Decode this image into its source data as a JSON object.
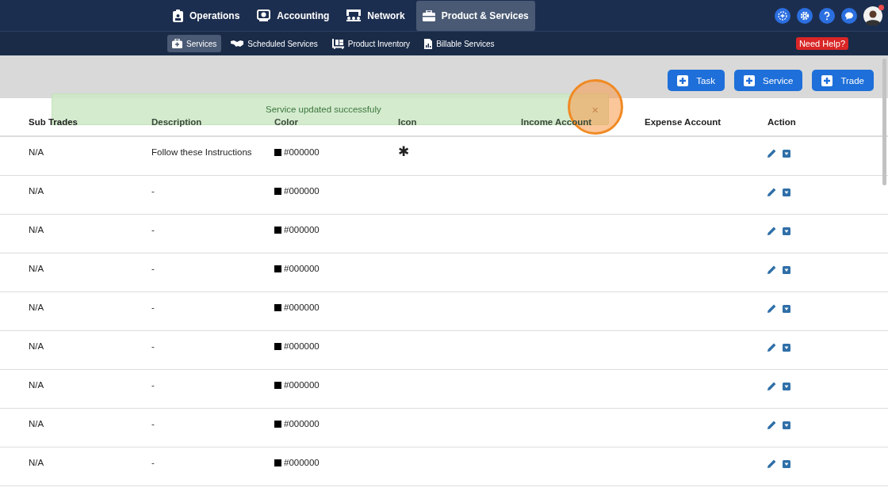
{
  "top_nav": [
    {
      "label": "Operations",
      "selected": false
    },
    {
      "label": "Accounting",
      "selected": false
    },
    {
      "label": "Network",
      "selected": false
    },
    {
      "label": "Product & Services",
      "selected": true
    }
  ],
  "sub_nav": [
    {
      "label": "Services",
      "selected": true
    },
    {
      "label": "Scheduled Services",
      "selected": false
    },
    {
      "label": "Product Inventory",
      "selected": false
    },
    {
      "label": "Billable Services",
      "selected": false
    }
  ],
  "help_badge": "Need Help?",
  "action_buttons": [
    "Task",
    "Service",
    "Trade"
  ],
  "toast": {
    "message": "Service updated successfuly",
    "close": "×"
  },
  "table": {
    "columns": [
      "Sub Trades",
      "Description",
      "Color",
      "Icon",
      "Income Account",
      "Expense Account",
      "Action"
    ],
    "rows": [
      {
        "sub_trade": "N/A",
        "description": "Follow these Instructions",
        "color": "#000000",
        "color_text": "#000000",
        "icon": "✱"
      },
      {
        "sub_trade": "N/A",
        "description": "-",
        "color": "#000000",
        "color_text": "#000000"
      },
      {
        "sub_trade": "N/A",
        "description": "-",
        "color": "#000000",
        "color_text": "#000000"
      },
      {
        "sub_trade": "N/A",
        "description": "-",
        "color": "#000000",
        "color_text": "#000000"
      },
      {
        "sub_trade": "N/A",
        "description": "-",
        "color": "#000000",
        "color_text": "#000000"
      },
      {
        "sub_trade": "N/A",
        "description": "-",
        "color": "#000000",
        "color_text": "#000000"
      },
      {
        "sub_trade": "N/A",
        "description": "-",
        "color": "#000000",
        "color_text": "#000000"
      },
      {
        "sub_trade": "N/A",
        "description": "-",
        "color": "#000000",
        "color_text": "#000000"
      },
      {
        "sub_trade": "N/A",
        "description": "-",
        "color": "#000000",
        "color_text": "#000000"
      }
    ]
  }
}
